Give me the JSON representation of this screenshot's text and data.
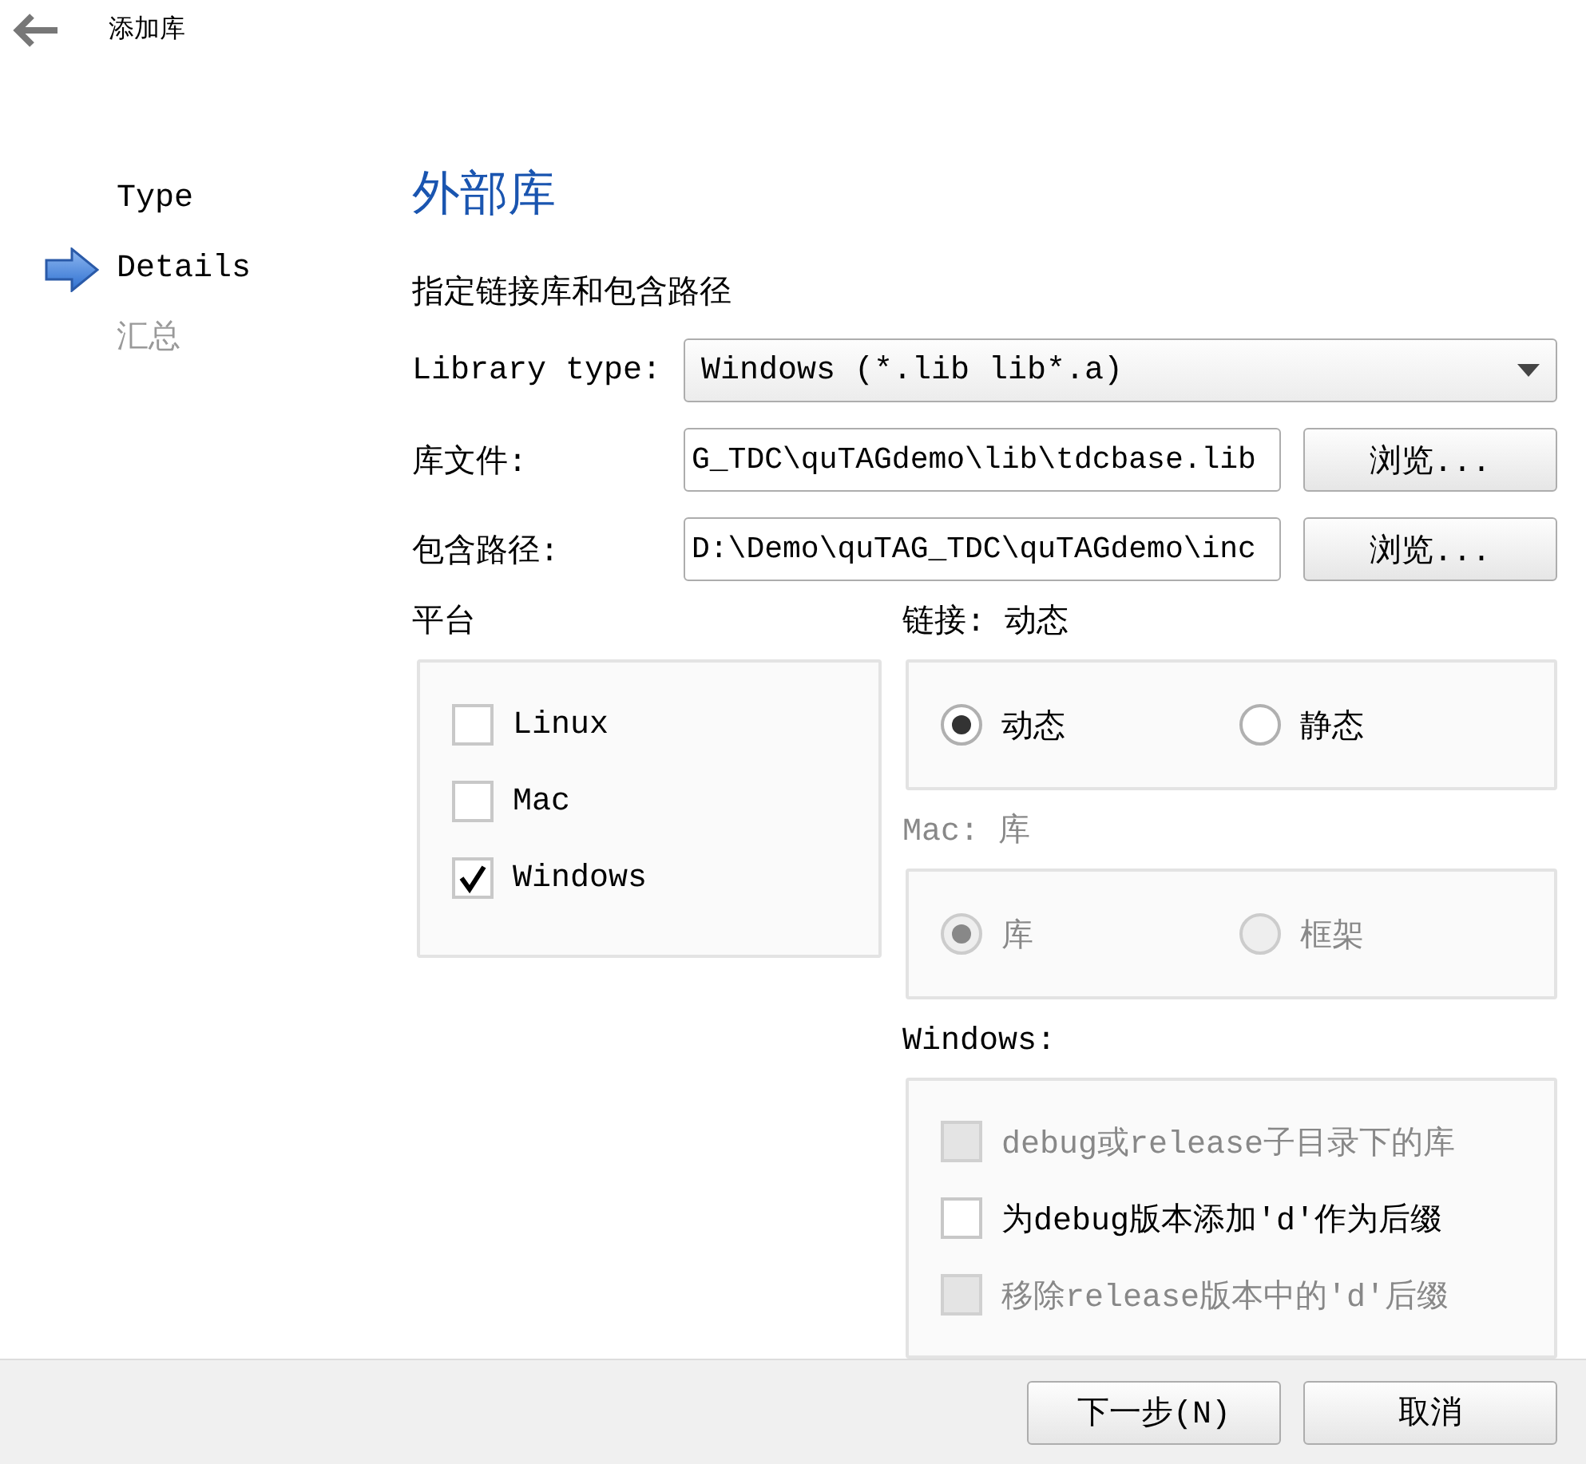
{
  "window": {
    "title": "添加库"
  },
  "steps": [
    {
      "label": "Type",
      "selected": false,
      "disabled": false
    },
    {
      "label": "Details",
      "selected": true,
      "disabled": false
    },
    {
      "label": "汇总",
      "selected": false,
      "disabled": true
    }
  ],
  "page": {
    "title": "外部库",
    "subtitle": "指定链接库和包含路径"
  },
  "fields": [
    {
      "kind": "dropdown",
      "label": "Library type:",
      "value": "Windows (*.lib lib*.a)"
    },
    {
      "kind": "path",
      "label": "库文件:",
      "value": "G_TDC\\quTAGdemo\\lib\\tdcbase.lib",
      "button": "浏览..."
    },
    {
      "kind": "path",
      "label": "包含路径:",
      "value": "D:\\Demo\\quTAG_TDC\\quTAGdemo\\inc",
      "button": "浏览..."
    }
  ],
  "platform": {
    "title": "平台",
    "options": [
      {
        "label": "Linux",
        "checked": false
      },
      {
        "label": "Mac",
        "checked": false
      },
      {
        "label": "Windows",
        "checked": true
      }
    ]
  },
  "radio_groups": [
    {
      "title": "链接: 动态",
      "disabled": false,
      "options": [
        {
          "label": "动态",
          "selected": true
        },
        {
          "label": "静态",
          "selected": false
        }
      ]
    },
    {
      "title": "Mac: 库",
      "disabled": true,
      "options": [
        {
          "label": "库",
          "selected": true
        },
        {
          "label": "框架",
          "selected": false
        }
      ]
    }
  ],
  "windows": {
    "title": "Windows:",
    "options": [
      {
        "label": "debug或release子目录下的库",
        "checked": false,
        "disabled": true
      },
      {
        "label": "为debug版本添加'd'作为后缀",
        "checked": false,
        "disabled": false
      },
      {
        "label": "移除release版本中的'd'后缀",
        "checked": false,
        "disabled": true
      }
    ]
  },
  "buttons": [
    {
      "label": "下一步(N)"
    },
    {
      "label": "取消"
    }
  ]
}
